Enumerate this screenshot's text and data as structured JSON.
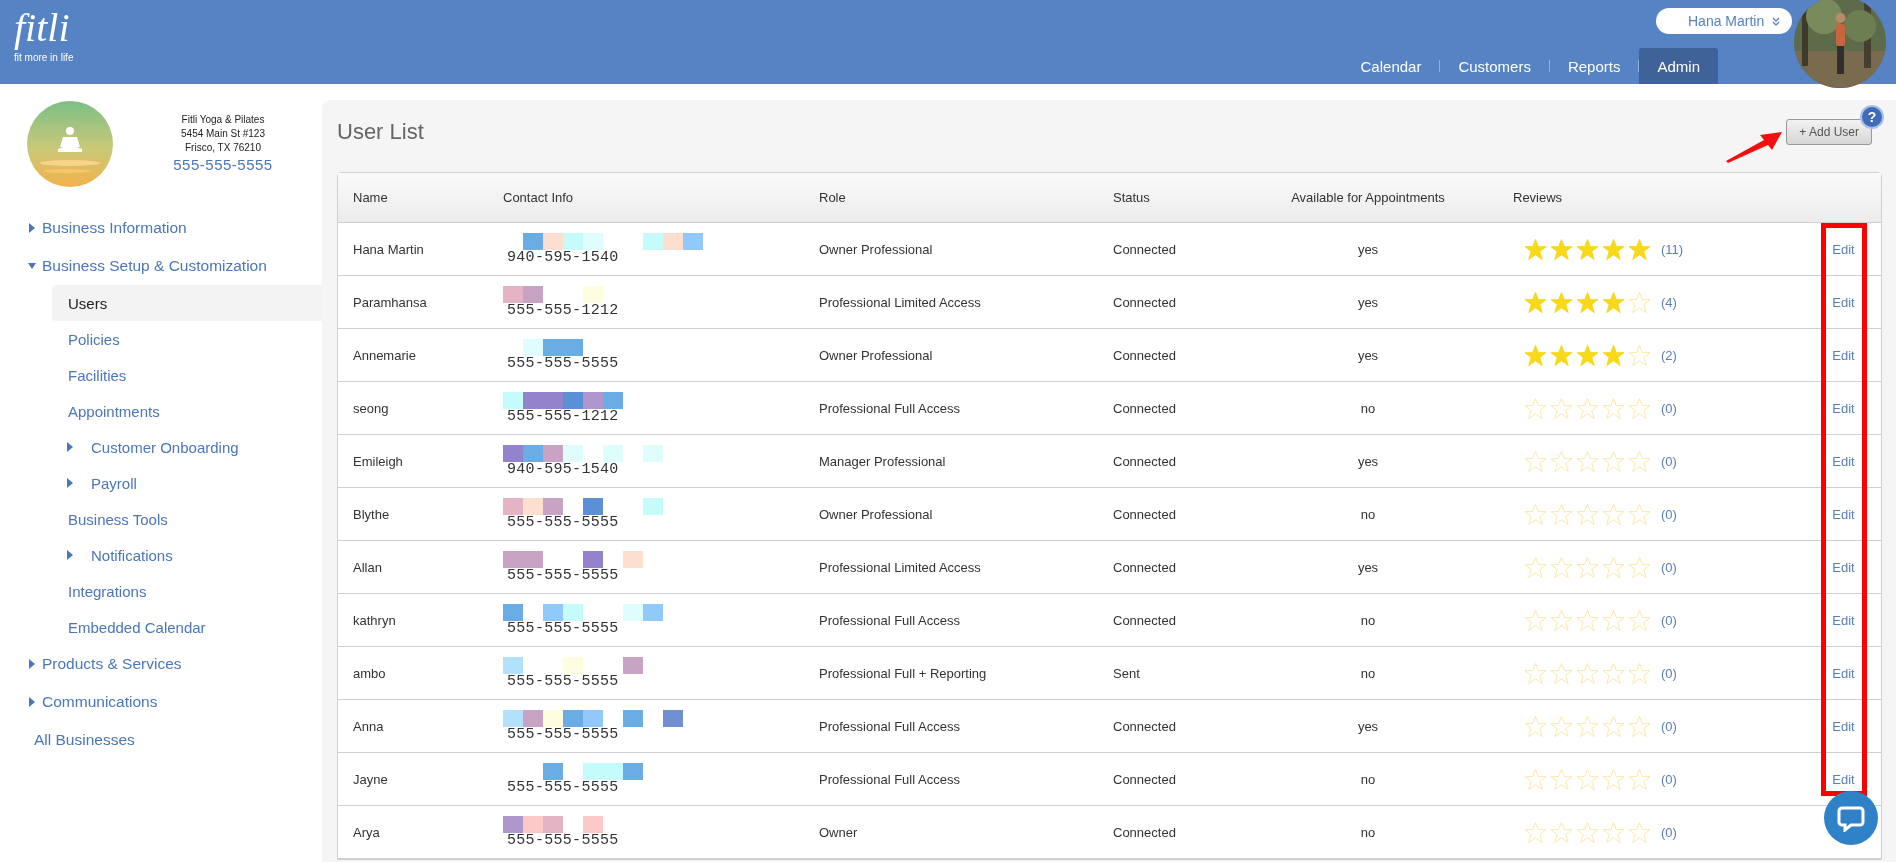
{
  "header": {
    "logo": {
      "name": "fitli",
      "tagline": "fit more in life"
    },
    "user_menu": {
      "name": "Hana Martin"
    },
    "nav_tabs": [
      {
        "label": "Calendar",
        "selected": false
      },
      {
        "label": "Customers",
        "selected": false
      },
      {
        "label": "Reports",
        "selected": false
      },
      {
        "label": "Admin",
        "selected": true
      }
    ]
  },
  "business": {
    "name": "Fitli Yoga & Pilates",
    "address": "5454 Main St #123",
    "city": "Frisco, TX 76210",
    "phone": "555-555-5555"
  },
  "sidebar": {
    "items": [
      {
        "label": "Business Information",
        "expanded": false,
        "selected": false
      },
      {
        "label": "Business Setup & Customization",
        "expanded": true,
        "selected": false,
        "children": [
          {
            "label": "Users",
            "selected": true
          },
          {
            "label": "Policies",
            "selected": false
          },
          {
            "label": "Facilities",
            "selected": false
          },
          {
            "label": "Appointments",
            "selected": false
          },
          {
            "label": "Customer Onboarding",
            "expanded": false,
            "selected": false
          },
          {
            "label": "Payroll",
            "expanded": false,
            "selected": false
          },
          {
            "label": "Business Tools",
            "selected": false
          },
          {
            "label": "Notifications",
            "expanded": false,
            "selected": false
          },
          {
            "label": "Integrations",
            "selected": false
          },
          {
            "label": "Embedded Calendar",
            "selected": false
          }
        ]
      },
      {
        "label": "Products & Services",
        "expanded": false,
        "selected": false
      },
      {
        "label": "Communications",
        "expanded": false,
        "selected": false
      },
      {
        "label": "All Businesses",
        "selected": false
      }
    ]
  },
  "page": {
    "title": "User List",
    "add_button": "+ Add User",
    "help": "?"
  },
  "table": {
    "columns": [
      "Name",
      "Contact Info",
      "Role",
      "Status",
      "Available for Appointments",
      "Reviews"
    ],
    "rows": [
      {
        "name": "Hana Martin",
        "phone": "940-595-1540",
        "role": "Owner Professional",
        "status": "Connected",
        "available": "yes",
        "stars": 5,
        "review_count": "(11)",
        "action": "Edit"
      },
      {
        "name": "Paramhansa",
        "phone": "555-555-1212",
        "role": "Professional Limited Access",
        "status": "Connected",
        "available": "yes",
        "stars": 4,
        "review_count": "(4)",
        "action": "Edit"
      },
      {
        "name": "Annemarie",
        "phone": "555-555-5555",
        "role": "Owner Professional",
        "status": "Connected",
        "available": "yes",
        "stars": 4,
        "review_count": "(2)",
        "action": "Edit"
      },
      {
        "name": "seong",
        "phone": "555-555-1212",
        "role": "Professional Full Access",
        "status": "Connected",
        "available": "no",
        "stars": 0,
        "review_count": "(0)",
        "action": "Edit"
      },
      {
        "name": "Emileigh",
        "phone": "940-595-1540",
        "role": "Manager Professional",
        "status": "Connected",
        "available": "yes",
        "stars": 0,
        "review_count": "(0)",
        "action": "Edit"
      },
      {
        "name": "Blythe",
        "phone": "555-555-5555",
        "role": "Owner Professional",
        "status": "Connected",
        "available": "no",
        "stars": 0,
        "review_count": "(0)",
        "action": "Edit"
      },
      {
        "name": "Allan",
        "phone": "555-555-5555",
        "role": "Professional Limited Access",
        "status": "Connected",
        "available": "yes",
        "stars": 0,
        "review_count": "(0)",
        "action": "Edit"
      },
      {
        "name": "kathryn",
        "phone": "555-555-5555",
        "role": "Professional Full Access",
        "status": "Connected",
        "available": "no",
        "stars": 0,
        "review_count": "(0)",
        "action": "Edit"
      },
      {
        "name": "ambo",
        "phone": "555-555-5555",
        "role": "Professional Full + Reporting",
        "status": "Sent",
        "available": "no",
        "stars": 0,
        "review_count": "(0)",
        "action": "Edit"
      },
      {
        "name": "Anna",
        "phone": "555-555-5555",
        "role": "Professional Full Access",
        "status": "Connected",
        "available": "yes",
        "stars": 0,
        "review_count": "(0)",
        "action": "Edit"
      },
      {
        "name": "Jayne",
        "phone": "555-555-5555",
        "role": "Professional Full Access",
        "status": "Connected",
        "available": "no",
        "stars": 0,
        "review_count": "(0)",
        "action": "Edit"
      },
      {
        "name": "Arya",
        "phone": "555-555-5555",
        "role": "Owner",
        "status": "Connected",
        "available": "no",
        "stars": 0,
        "review_count": "(0)"
      }
    ]
  }
}
